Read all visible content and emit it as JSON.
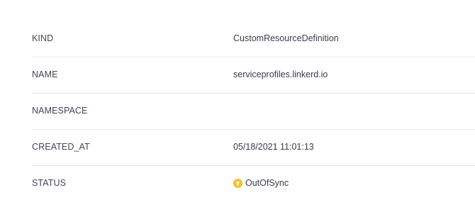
{
  "details": {
    "rows": [
      {
        "key": "KIND",
        "value": "CustomResourceDefinition"
      },
      {
        "key": "NAME",
        "value": "serviceprofiles.linkerd.io"
      },
      {
        "key": "NAMESPACE",
        "value": ""
      },
      {
        "key": "CREATED_AT",
        "value": "05/18/2021 11:01:13"
      },
      {
        "key": "STATUS",
        "value": "OutOfSync",
        "icon": "out-of-sync-arrow-up-icon",
        "icon_color": "#f4c030"
      }
    ]
  }
}
